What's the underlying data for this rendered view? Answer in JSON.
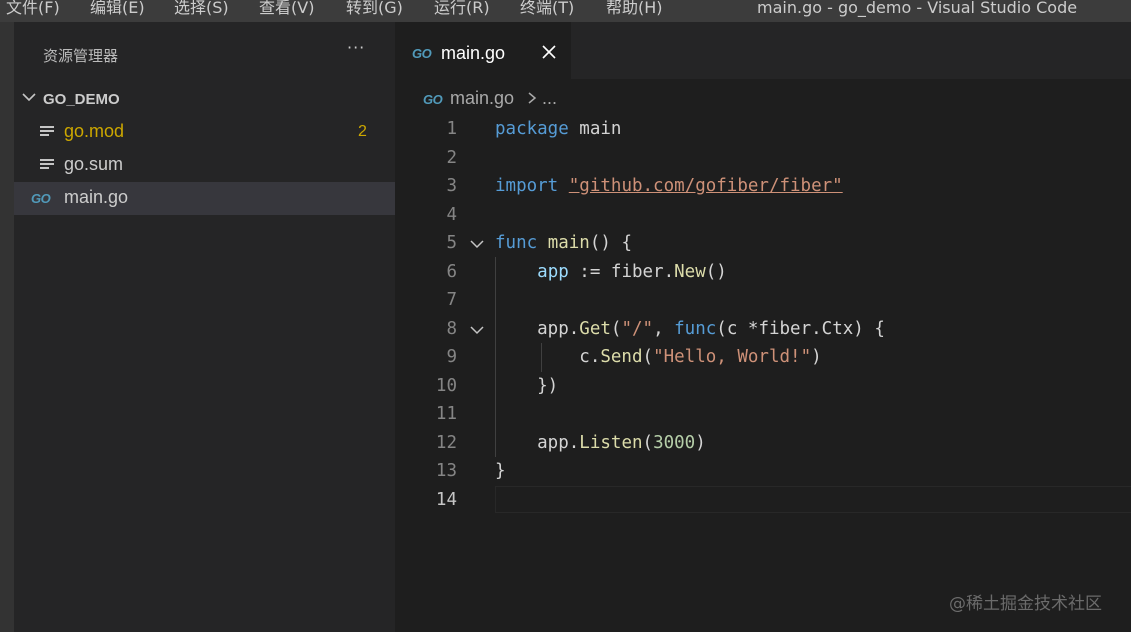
{
  "menu": {
    "items": [
      "文件(F)",
      "编辑(E)",
      "选择(S)",
      "查看(V)",
      "转到(G)",
      "运行(R)",
      "终端(T)",
      "帮助(H)"
    ],
    "window_title": "main.go - go_demo - Visual Studio Code"
  },
  "sidebar": {
    "title": "资源管理器",
    "more": "···",
    "folder": "GO_DEMO",
    "files": [
      {
        "name": "go.mod",
        "icon": "lines-icon",
        "badge": "2",
        "status": "warning"
      },
      {
        "name": "go.sum",
        "icon": "lines-icon",
        "badge": "",
        "status": "normal"
      },
      {
        "name": "main.go",
        "icon": "go-icon",
        "badge": "",
        "status": "selected"
      }
    ]
  },
  "tabs": [
    {
      "label": "main.go",
      "icon": "go-icon",
      "active": true
    }
  ],
  "breadcrumb": {
    "file": "main.go",
    "more": "..."
  },
  "go_icon_text": "GO",
  "editor": {
    "line_numbers": [
      "1",
      "2",
      "3",
      "4",
      "5",
      "6",
      "7",
      "8",
      "9",
      "10",
      "11",
      "12",
      "13",
      "14"
    ],
    "current_line": 14,
    "lines": [
      [
        [
          "kw",
          "package"
        ],
        [
          "plain",
          " main"
        ]
      ],
      [],
      [
        [
          "kw",
          "import"
        ],
        [
          "plain",
          " "
        ],
        [
          "str ul",
          "\"github.com/gofiber/fiber\""
        ]
      ],
      [],
      [
        [
          "kw",
          "func"
        ],
        [
          "plain",
          " "
        ],
        [
          "fn",
          "main"
        ],
        [
          "plain",
          "() {"
        ]
      ],
      [
        [
          "plain",
          "    "
        ],
        [
          "var",
          "app"
        ],
        [
          "plain",
          " := fiber."
        ],
        [
          "fn",
          "New"
        ],
        [
          "plain",
          "()"
        ]
      ],
      [],
      [
        [
          "plain",
          "    app."
        ],
        [
          "fn",
          "Get"
        ],
        [
          "plain",
          "("
        ],
        [
          "str",
          "\"/\""
        ],
        [
          "plain",
          ", "
        ],
        [
          "kw",
          "func"
        ],
        [
          "plain",
          "(c *fiber.Ctx) {"
        ]
      ],
      [
        [
          "plain",
          "        c."
        ],
        [
          "fn",
          "Send"
        ],
        [
          "plain",
          "("
        ],
        [
          "str",
          "\"Hello, World!\""
        ],
        [
          "plain",
          ")"
        ]
      ],
      [
        [
          "plain",
          "    })"
        ]
      ],
      [],
      [
        [
          "plain",
          "    app."
        ],
        [
          "fn",
          "Listen"
        ],
        [
          "plain",
          "("
        ],
        [
          "num",
          "3000"
        ],
        [
          "plain",
          ")"
        ]
      ],
      [
        [
          "plain",
          "}"
        ]
      ],
      []
    ],
    "fold_lines": [
      5,
      8
    ]
  },
  "watermark": "@稀土掘金技术社区",
  "colors": {
    "keyword": "#569cd6",
    "string": "#ce9178",
    "number": "#b5cea8",
    "function": "#dcdcaa",
    "variable": "#9cdcfe",
    "warning": "#cca700",
    "go_icon": "#519aba"
  }
}
